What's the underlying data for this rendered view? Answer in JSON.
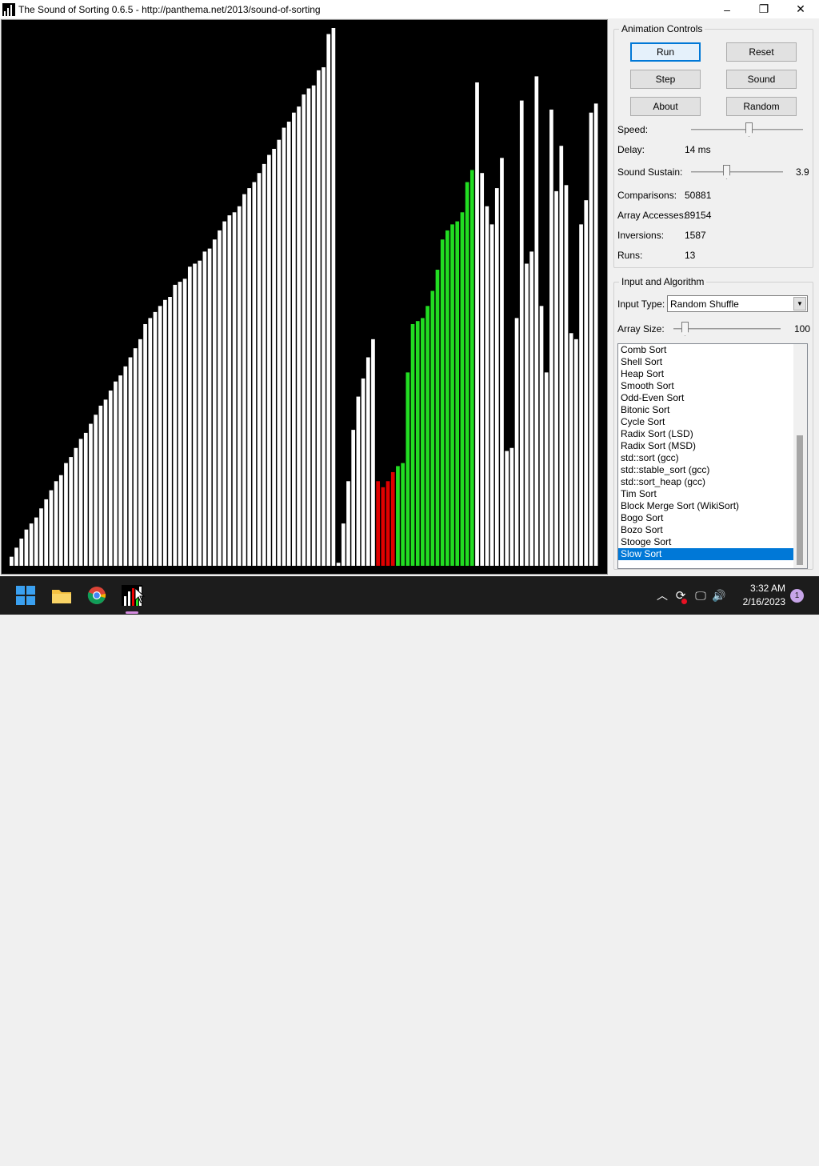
{
  "window": {
    "title": "The Sound of Sorting 0.6.5 - http://panthema.net/2013/sound-of-sorting",
    "minimize": "–",
    "maximize": "❐",
    "close": "✕"
  },
  "visualization": {
    "bar_values": [
      3,
      6,
      9,
      12,
      14,
      16,
      19,
      22,
      25,
      28,
      30,
      34,
      36,
      39,
      42,
      44,
      47,
      50,
      53,
      55,
      58,
      61,
      63,
      66,
      69,
      72,
      75,
      80,
      82,
      84,
      86,
      88,
      89,
      93,
      94,
      95,
      99,
      100,
      101,
      104,
      105,
      108,
      111,
      114,
      116,
      117,
      119,
      123,
      125,
      127,
      130,
      133,
      136,
      138,
      141,
      145,
      147,
      150,
      152,
      156,
      158,
      159,
      164,
      165,
      176,
      178,
      1,
      14,
      28,
      45,
      56,
      62,
      69,
      75,
      28,
      26,
      28,
      31,
      33,
      34,
      64,
      80,
      81,
      82,
      86,
      91,
      98,
      108,
      111,
      113,
      114,
      117,
      127,
      131,
      160,
      130,
      119,
      113,
      125,
      135,
      38,
      39,
      82,
      154,
      100,
      104,
      162,
      86,
      64,
      151,
      124,
      139,
      126,
      77,
      75,
      113,
      121,
      150,
      153
    ],
    "bar_colors": [
      "w",
      "w",
      "w",
      "w",
      "w",
      "w",
      "w",
      "w",
      "w",
      "w",
      "w",
      "w",
      "w",
      "w",
      "w",
      "w",
      "w",
      "w",
      "w",
      "w",
      "w",
      "w",
      "w",
      "w",
      "w",
      "w",
      "w",
      "w",
      "w",
      "w",
      "w",
      "w",
      "w",
      "w",
      "w",
      "w",
      "w",
      "w",
      "w",
      "w",
      "w",
      "w",
      "w",
      "w",
      "w",
      "w",
      "w",
      "w",
      "w",
      "w",
      "w",
      "w",
      "w",
      "w",
      "w",
      "w",
      "w",
      "w",
      "w",
      "w",
      "w",
      "w",
      "w",
      "w",
      "w",
      "w",
      "w",
      "w",
      "w",
      "w",
      "w",
      "w",
      "w",
      "w",
      "r",
      "r",
      "r",
      "r",
      "g",
      "g",
      "g",
      "g",
      "g",
      "g",
      "g",
      "g",
      "g",
      "g",
      "g",
      "g",
      "g",
      "g",
      "g",
      "g",
      "w",
      "w",
      "w",
      "w",
      "w",
      "w",
      "w",
      "w",
      "w",
      "w",
      "w",
      "w",
      "w",
      "w",
      "w",
      "w",
      "w",
      "w",
      "w",
      "w",
      "w",
      "w",
      "w",
      "w"
    ],
    "colors": {
      "w": "#ffffff",
      "r": "#e00000",
      "g": "#22dd22",
      "background": "#000000"
    }
  },
  "animation_controls": {
    "legend": "Animation Controls",
    "buttons": {
      "run": "Run",
      "reset": "Reset",
      "step": "Step",
      "sound": "Sound",
      "about": "About",
      "random": "Random"
    },
    "speed_label": "Speed:",
    "speed_level": 0.52,
    "delay_label": "Delay:",
    "delay_value": "14 ms",
    "sustain_label": "Sound Sustain:",
    "sustain_value": "3.9",
    "sustain_level": 0.38,
    "stats": [
      {
        "label": "Comparisons:",
        "value": "50881"
      },
      {
        "label": "Array Accesses:",
        "value": "89154"
      },
      {
        "label": "Inversions:",
        "value": "1587"
      },
      {
        "label": "Runs:",
        "value": "13"
      }
    ]
  },
  "input_algorithm": {
    "legend": "Input and Algorithm",
    "input_type_label": "Input Type:",
    "input_type_value": "Random Shuffle",
    "array_size_label": "Array Size:",
    "array_size_value": "100",
    "array_size_level": 0.08,
    "algorithms": [
      "Comb Sort",
      "Shell Sort",
      "Heap Sort",
      "Smooth Sort",
      "Odd-Even Sort",
      "Bitonic Sort",
      "Cycle Sort",
      "Radix Sort (LSD)",
      "Radix Sort (MSD)",
      "std::sort (gcc)",
      "std::stable_sort (gcc)",
      "std::sort_heap (gcc)",
      "Tim Sort",
      "Block Merge Sort (WikiSort)",
      "Bogo Sort",
      "Bozo Sort",
      "Stooge Sort",
      "Slow Sort"
    ],
    "selected_algorithm": "Slow Sort"
  },
  "taskbar": {
    "clock_time": "3:32 AM",
    "clock_date": "2/16/2023",
    "notification_count": "1"
  }
}
